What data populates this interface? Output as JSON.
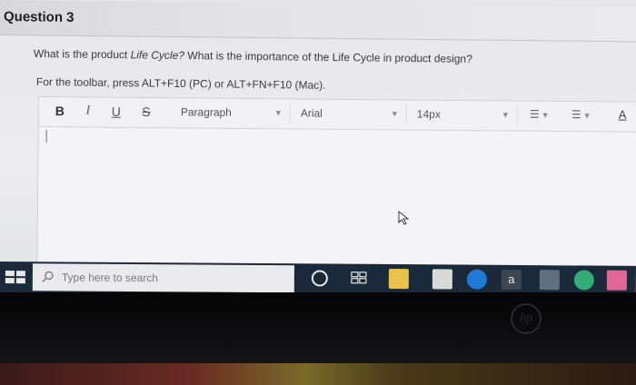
{
  "question": {
    "title": "Question 3",
    "prompt_before": "What is the product ",
    "prompt_em": "Life Cycle?",
    "prompt_after": " What is the importance of the Life Cycle in product design?",
    "toolbar_hint": "For the toolbar, press ALT+F10 (PC) or ALT+FN+F10 (Mac)."
  },
  "toolbar": {
    "bold": "B",
    "italic": "I",
    "underline": "U",
    "strike": "S",
    "paragraph": "Paragraph",
    "font": "Arial",
    "size": "14px",
    "color_label": "A"
  },
  "taskbar": {
    "search_placeholder": "Type here to search",
    "amazon_label": "a"
  },
  "brand": {
    "logo": "hp"
  }
}
